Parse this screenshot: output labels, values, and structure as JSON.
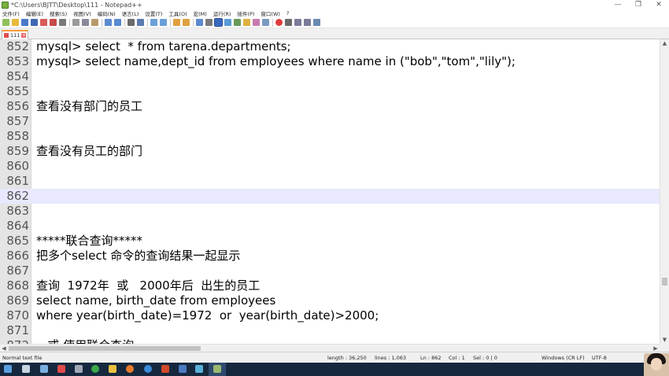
{
  "window": {
    "title": "*C:\\Users\\BJTT\\Desktop\\111 - Notepad++",
    "controls": {
      "minimize": "—",
      "maximize": "❐",
      "close": "✕"
    }
  },
  "menu": [
    "文件(F)",
    "编辑(E)",
    "搜索(S)",
    "视图(V)",
    "编码(N)",
    "语言(L)",
    "设置(T)",
    "工具(O)",
    "宏(M)",
    "运行(R)",
    "插件(P)",
    "窗口(W)",
    "?"
  ],
  "tab": {
    "label": "111"
  },
  "editor": {
    "current_line": "862",
    "lines": [
      {
        "n": "852",
        "text": "mysql> select  * from tarena.departments;"
      },
      {
        "n": "853",
        "text": "mysql> select name,dept_id from employees where name in (\"bob\",\"tom\",\"lily\");"
      },
      {
        "n": "854",
        "text": ""
      },
      {
        "n": "855",
        "text": ""
      },
      {
        "n": "856",
        "text": "查看没有部门的员工"
      },
      {
        "n": "857",
        "text": ""
      },
      {
        "n": "858",
        "text": ""
      },
      {
        "n": "859",
        "text": "查看没有员工的部门"
      },
      {
        "n": "860",
        "text": ""
      },
      {
        "n": "861",
        "text": ""
      },
      {
        "n": "862",
        "text": ""
      },
      {
        "n": "863",
        "text": ""
      },
      {
        "n": "864",
        "text": ""
      },
      {
        "n": "865",
        "text": "*****联合查询*****"
      },
      {
        "n": "866",
        "text": "把多个select 命令的查询结果一起显示"
      },
      {
        "n": "867",
        "text": ""
      },
      {
        "n": "868",
        "text": "查询  1972年  或   2000年后  出生的员工"
      },
      {
        "n": "869",
        "text": "select name, birth_date from employees"
      },
      {
        "n": "870",
        "text": "where year(birth_date)=1972  or  year(birth_date)>2000;"
      },
      {
        "n": "871",
        "text": ""
      },
      {
        "n": "872",
        "text": "   或 使用联合查询"
      }
    ]
  },
  "status": {
    "file_type": "Normal text file",
    "length": "length : 36,250",
    "lines": "lines : 1,063",
    "ln": "Ln : 862",
    "col": "Col : 1",
    "sel": "Sel : 0 | 0",
    "eol": "Windows (CR LF)",
    "encoding": "UTF-8"
  },
  "toolbar_icons": [
    "new-icon",
    "open-icon",
    "save-icon",
    "save-all-icon",
    "close-icon",
    "close-all-icon",
    "print-icon",
    "cut-icon",
    "copy-icon",
    "paste-icon",
    "undo-icon",
    "redo-icon",
    "find-icon",
    "replace-icon",
    "zoom-in-icon",
    "zoom-out-icon",
    "sync-v-icon",
    "sync-h-icon",
    "wrap-icon",
    "all-chars-icon",
    "indent-guide-icon",
    "doc-map-icon",
    "function-list-icon",
    "folder-workspace-icon",
    "monitor-icon",
    "record-macro-icon",
    "stop-macro-icon",
    "play-macro-icon",
    "run-macro-icon",
    "save-macro-icon"
  ],
  "taskbar_icons": [
    "start-icon",
    "task-view-icon",
    "network-icon",
    "app-icon",
    "folder-icon",
    "chrome-icon",
    "files-icon",
    "firefox-icon",
    "edge-icon",
    "powerpoint-icon",
    "terminal-icon",
    "image-viewer-icon",
    "notepadpp-icon"
  ]
}
